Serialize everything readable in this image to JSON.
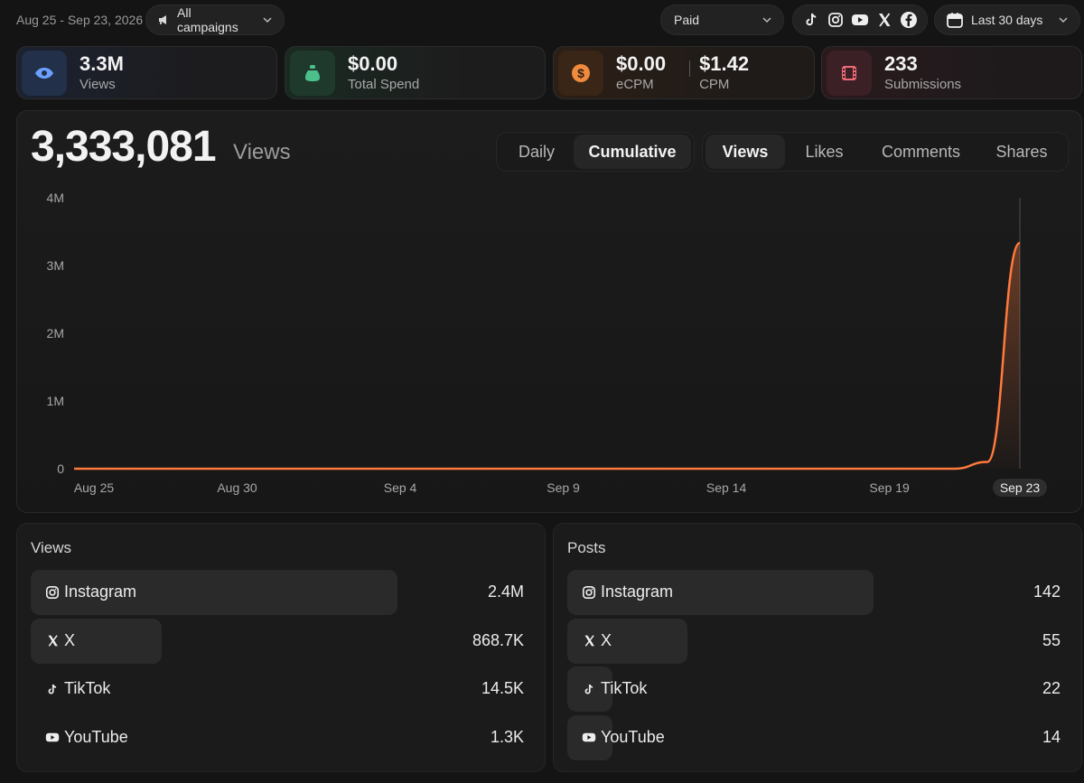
{
  "header": {
    "date_range": "Aug 25 - Sep 23, 2026",
    "campaigns_label": "All campaigns",
    "paid_label": "Paid",
    "period_label": "Last 30 days",
    "platform_icons": [
      "tiktok-icon",
      "instagram-icon",
      "youtube-icon",
      "x-icon",
      "facebook-icon"
    ]
  },
  "stats": {
    "views": {
      "value": "3.3M",
      "label": "Views",
      "color": "#6aa0ff"
    },
    "spend": {
      "value": "$0.00",
      "label": "Total Spend",
      "color": "#4cc08a"
    },
    "ecpm": {
      "value": "$0.00",
      "label": "eCPM",
      "color": "#f08a3c"
    },
    "cpm": {
      "value": "$1.42",
      "label": "CPM"
    },
    "submissions": {
      "value": "233",
      "label": "Submissions",
      "color": "#f06a78"
    }
  },
  "chart_panel": {
    "total": "3,333,081",
    "unit": "Views",
    "mode_tabs": [
      "Daily",
      "Cumulative"
    ],
    "active_mode": "Cumulative",
    "metric_tabs": [
      "Views",
      "Likes",
      "Comments",
      "Shares"
    ],
    "active_metric": "Views"
  },
  "chart_data": {
    "type": "area",
    "title": "",
    "xlabel": "",
    "ylabel": "",
    "x_ticks": [
      "Aug 25",
      "Aug 30",
      "Sep 4",
      "Sep 9",
      "Sep 14",
      "Sep 19",
      "Sep 23"
    ],
    "y_ticks": [
      "0",
      "1M",
      "2M",
      "3M",
      "4M"
    ],
    "ylim": [
      0,
      4000000
    ],
    "series": [
      {
        "color": "#ff7a3d",
        "points": [
          [
            "Aug 25",
            0
          ],
          [
            "Aug 30",
            0
          ],
          [
            "Sep 4",
            0
          ],
          [
            "Sep 9",
            0
          ],
          [
            "Sep 14",
            0
          ],
          [
            "Sep 19",
            0
          ],
          [
            "Sep 21",
            0
          ],
          [
            "Sep 22",
            100000
          ],
          [
            "Sep 23",
            3333081
          ]
        ]
      }
    ],
    "highlighted_x": "Sep 23",
    "grid": false
  },
  "views_panel": {
    "title": "Views",
    "rows": [
      {
        "name": "Instagram",
        "value": "2.4M",
        "icon": "instagram-icon",
        "share": 0.73
      },
      {
        "name": "X",
        "value": "868.7K",
        "icon": "x-icon",
        "share": 0.26
      },
      {
        "name": "TikTok",
        "value": "14.5K",
        "icon": "tiktok-icon",
        "share": 0.0
      },
      {
        "name": "YouTube",
        "value": "1.3K",
        "icon": "youtube-icon",
        "share": 0.0
      }
    ]
  },
  "posts_panel": {
    "title": "Posts",
    "rows": [
      {
        "name": "Instagram",
        "value": "142",
        "icon": "instagram-icon",
        "share": 0.61
      },
      {
        "name": "X",
        "value": "55",
        "icon": "x-icon",
        "share": 0.24
      },
      {
        "name": "TikTok",
        "value": "22",
        "icon": "tiktok-icon",
        "share": 0.09
      },
      {
        "name": "YouTube",
        "value": "14",
        "icon": "youtube-icon",
        "share": 0.06
      }
    ]
  }
}
